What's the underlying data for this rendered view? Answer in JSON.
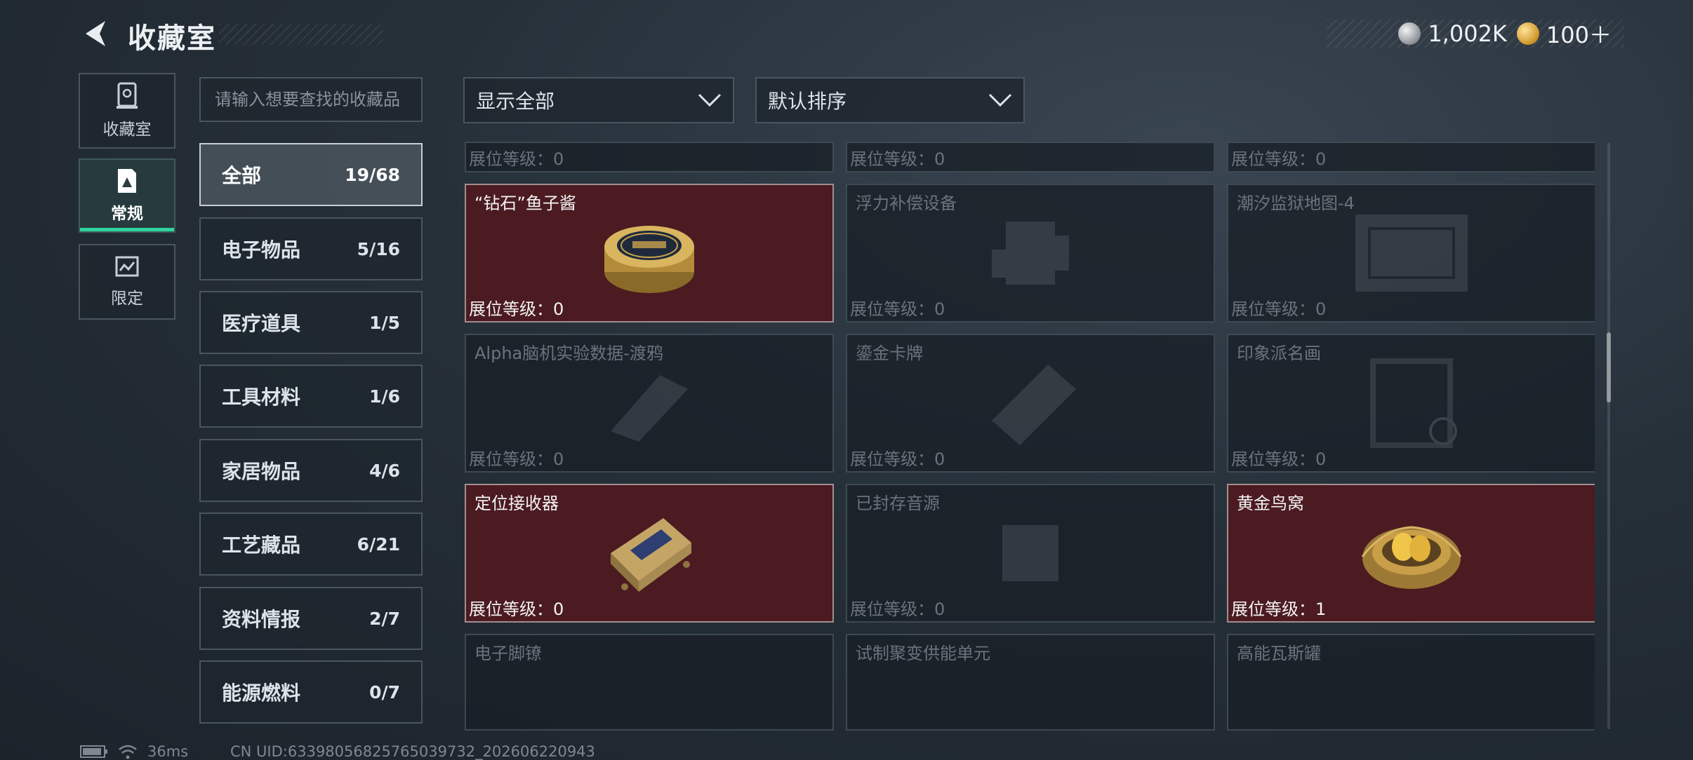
{
  "header": {
    "title": "收藏室",
    "currencies": [
      {
        "icon": "silver-coin-icon",
        "value": "1,002K"
      },
      {
        "icon": "gold-coin-icon",
        "value": "100＋"
      }
    ]
  },
  "nav": [
    {
      "label": "收藏室",
      "icon": "display-case-icon",
      "active": false
    },
    {
      "label": "常规",
      "icon": "regular-collection-icon",
      "active": true
    },
    {
      "label": "限定",
      "icon": "limited-collection-icon",
      "active": false
    }
  ],
  "search": {
    "placeholder": "请输入想要查找的收藏品",
    "value": ""
  },
  "categories": [
    {
      "name": "全部",
      "count": "19/68",
      "active": true
    },
    {
      "name": "电子物品",
      "count": "5/16"
    },
    {
      "name": "医疗道具",
      "count": "1/5"
    },
    {
      "name": "工具材料",
      "count": "1/6"
    },
    {
      "name": "家居物品",
      "count": "4/6"
    },
    {
      "name": "工艺藏品",
      "count": "6/21"
    },
    {
      "name": "资料情报",
      "count": "2/7"
    },
    {
      "name": "能源燃料",
      "count": "0/7"
    }
  ],
  "filters": {
    "show": {
      "value": "显示全部",
      "icon": "chevron-down-icon"
    },
    "sort": {
      "value": "默认排序",
      "icon": "chevron-down-icon"
    }
  },
  "level_label": "展位等级：",
  "top_partial_row": [
    {
      "level": "0"
    },
    {
      "level": "0"
    },
    {
      "level": "0"
    }
  ],
  "items": [
    {
      "name": "“钻石”鱼子酱",
      "level": "0",
      "owned": true,
      "art": "caviar-tin-icon"
    },
    {
      "name": "浮力补偿设备",
      "level": "0",
      "owned": false,
      "art": "device-icon"
    },
    {
      "name": "潮汐监狱地图-4",
      "level": "0",
      "owned": false,
      "art": "map-icon"
    },
    {
      "name": "Alpha脑机实验数据-渡鸦",
      "level": "0",
      "owned": false,
      "art": "data-drive-icon"
    },
    {
      "name": "鎏金卡牌",
      "level": "0",
      "owned": false,
      "art": "card-icon"
    },
    {
      "name": "印象派名画",
      "level": "0",
      "owned": false,
      "art": "painting-icon"
    },
    {
      "name": "定位接收器",
      "level": "0",
      "owned": true,
      "art": "receiver-icon"
    },
    {
      "name": "已封存音源",
      "level": "0",
      "owned": false,
      "art": "audio-icon"
    },
    {
      "name": "黄金鸟窝",
      "level": "1",
      "owned": true,
      "art": "golden-nest-icon"
    },
    {
      "name": "电子脚镣",
      "level": "",
      "owned": false,
      "art": "ankle-monitor-icon"
    },
    {
      "name": "试制聚变供能单元",
      "level": "",
      "owned": false,
      "art": "fusion-unit-icon"
    },
    {
      "name": "高能瓦斯罐",
      "level": "",
      "owned": false,
      "art": "gas-canister-icon"
    }
  ],
  "status": {
    "ping": "36ms",
    "uid": "CN UID:63398056825765039732_202606220943"
  },
  "colors": {
    "accent": "#2ed49a",
    "owned_bg": "#4b1b21",
    "panel_border": "#4a5560"
  }
}
